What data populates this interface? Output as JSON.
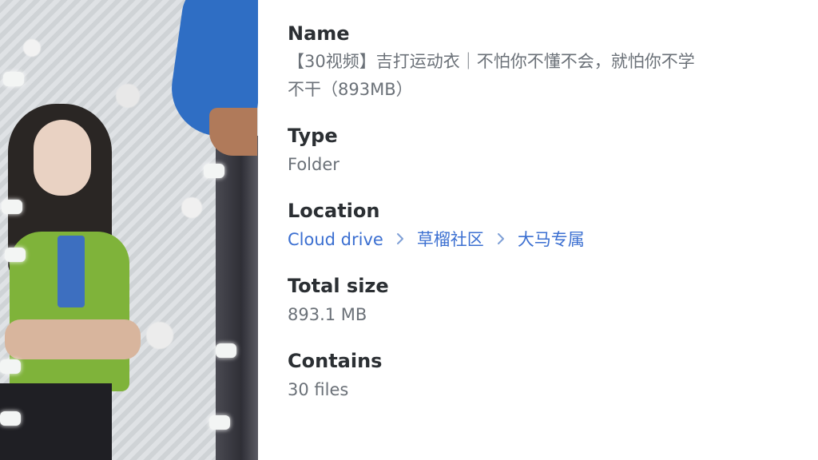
{
  "name": {
    "label": "Name",
    "value": "【30视频】吉打运动衣｜不怕你不懂不会，就怕你不学不干（893MB）"
  },
  "type": {
    "label": "Type",
    "value": "Folder"
  },
  "location": {
    "label": "Location",
    "path": [
      "Cloud drive",
      "草榴社区",
      "大马专属"
    ],
    "separator_icon": "chevron-right-icon",
    "link_color": "#3b6fd1"
  },
  "total_size": {
    "label": "Total size",
    "value": "893.1 MB"
  },
  "contains": {
    "label": "Contains",
    "value": "30 files"
  },
  "thumbnail": {
    "icon": "photo-thumbnail"
  }
}
